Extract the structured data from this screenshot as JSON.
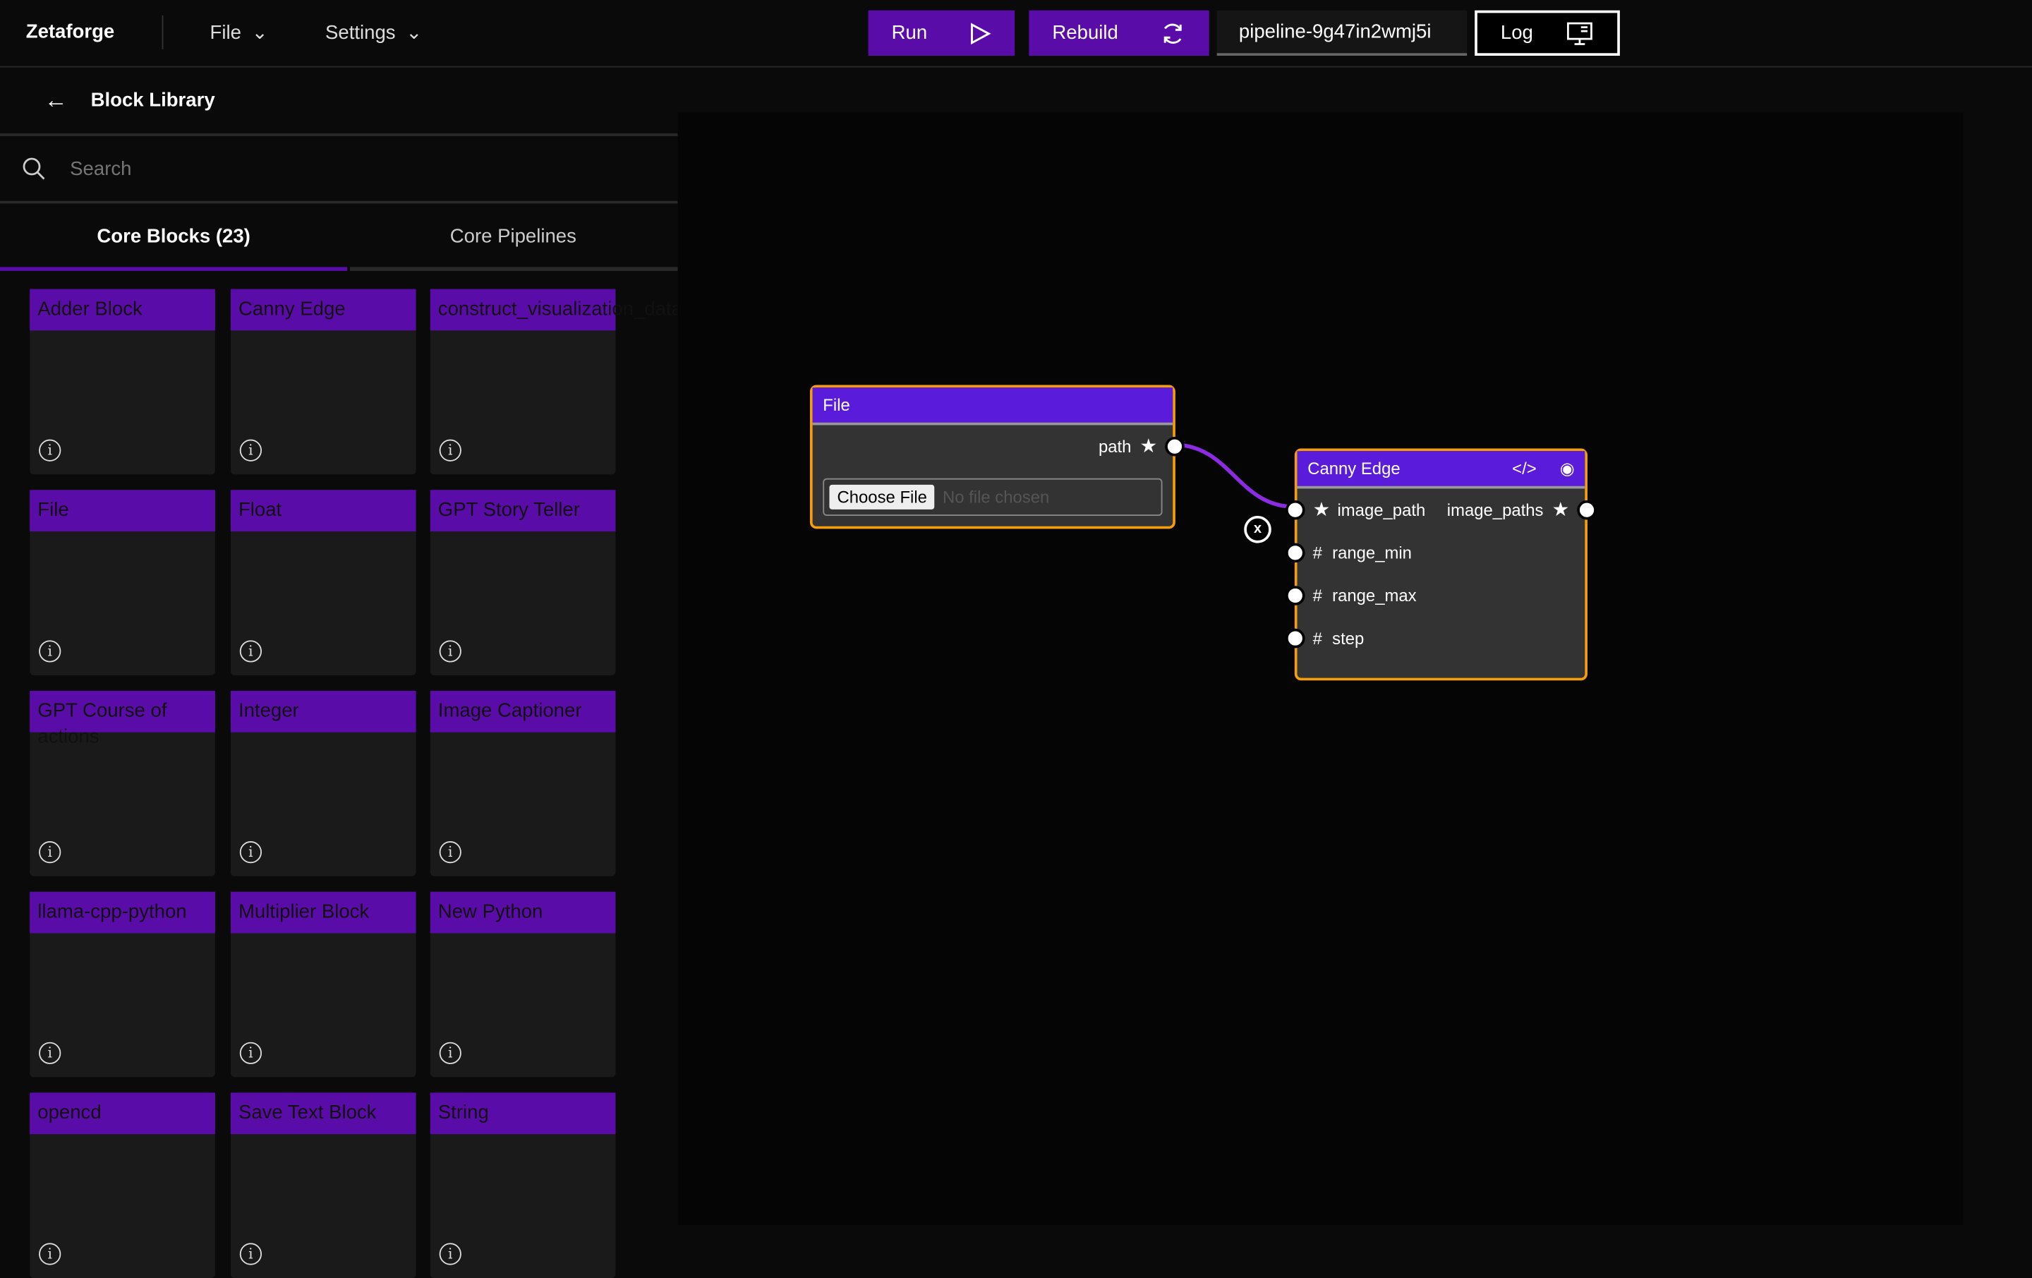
{
  "header": {
    "brand": "Zetaforge",
    "menus": [
      "File",
      "Settings"
    ],
    "run": "Run",
    "rebuild": "Rebuild",
    "pipeline_name": "pipeline-9g47in2wmj5i",
    "log": "Log"
  },
  "sidebar": {
    "title": "Block Library",
    "search_placeholder": "Search",
    "tabs": [
      "Core Blocks (23)",
      "Core Pipelines"
    ],
    "blocks": [
      "Adder Block",
      "Canny Edge",
      "construct_visualization_data",
      "File",
      "Float",
      "GPT Story Teller",
      "GPT Course of actions",
      "Integer",
      "Image Captioner",
      "llama-cpp-python",
      "Multiplier Block",
      "New Python",
      "opencd",
      "Save Text Block",
      "String"
    ]
  },
  "nodes": {
    "file": {
      "title": "File",
      "output": "path",
      "choose": "Choose File",
      "no_file": "No file chosen"
    },
    "canny": {
      "title": "Canny Edge",
      "inputs": [
        "image_path",
        "range_min",
        "range_max",
        "step"
      ],
      "output": "image_paths",
      "delete": "x"
    }
  },
  "colors": {
    "accent": "#5a0ca8",
    "node_header": "#5b1bdb",
    "node_border": "#f59e0b",
    "edge": "#8b2be2"
  }
}
